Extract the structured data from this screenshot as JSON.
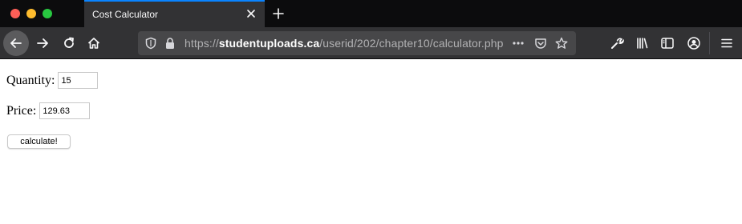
{
  "browser": {
    "tab_title": "Cost Calculator",
    "url_scheme": "https://",
    "url_domain": "studentuploads.ca",
    "url_path": "/userid/202/chapter10/calculator.php",
    "accent_color": "#0a84ff"
  },
  "form": {
    "quantity_label": "Quantity:",
    "quantity_value": "15",
    "price_label": "Price:",
    "price_value": "129.63",
    "submit_label": "calculate!"
  }
}
